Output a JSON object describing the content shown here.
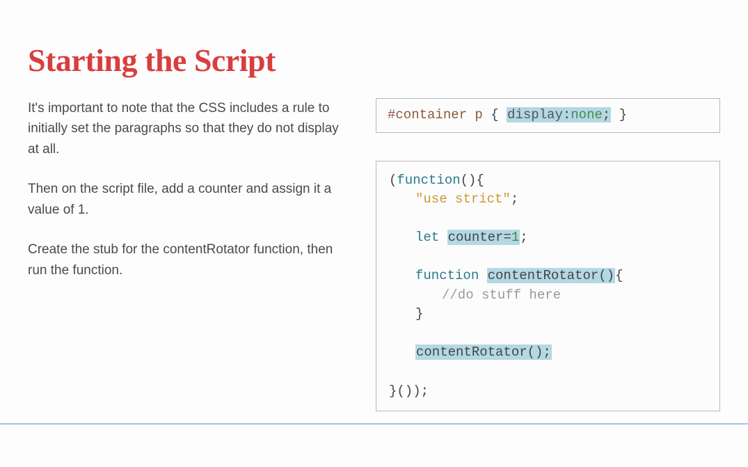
{
  "title": "Starting the Script",
  "paragraphs": {
    "p1": "It's important to note that the CSS includes a rule to initially set the paragraphs so that they do not display at all.",
    "p2": "Then on the script file, add a counter and assign it a value of 1.",
    "p3": "Create the stub for the contentRotator function, then run the function."
  },
  "css_code": {
    "selector": "#container p",
    "brace_open": "{",
    "prop": "display",
    "colon": ":",
    "val": "none",
    "semicolon": ";",
    "brace_close": "}"
  },
  "js_code": {
    "line1a": "(",
    "line1b": "function",
    "line1c": "(){",
    "line2": "\"use strict\"",
    "line2b": ";",
    "line3a": "let",
    "line3b": "counter=",
    "line3c": "1",
    "line3d": ";",
    "line4a": "function",
    "line4b": "contentRotator()",
    "line4c": "{",
    "line5": "//do stuff here",
    "line6": "}",
    "line7": "contentRotator();",
    "line8": "}());"
  }
}
